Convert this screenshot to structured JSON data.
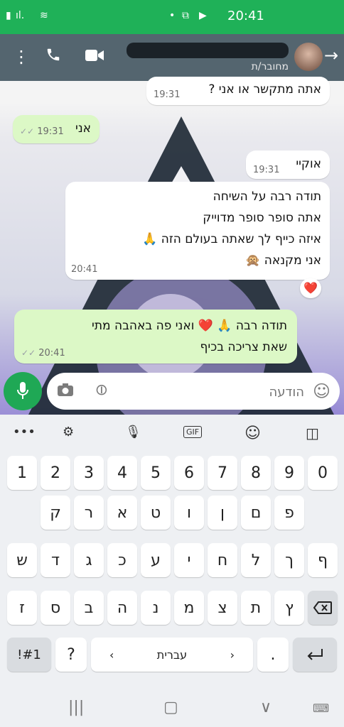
{
  "status_bar": {
    "time": "20:41"
  },
  "header": {
    "contact_status": "מחובר/ת"
  },
  "messages": [
    {
      "text": "אתה מתקשר או אני ?",
      "time": "19:31"
    },
    {
      "text": "אני",
      "time": "19:31"
    },
    {
      "text": "אוקיי",
      "time": "19:31"
    },
    {
      "lines": [
        "תודה רבה על השיחה",
        "אתה סופר סופר מדוייק",
        "איזה כייף לך שאתה בעולם הזה 🙏",
        "אני מקנאה 🙊"
      ],
      "time": "20:41",
      "reaction": "❤️"
    },
    {
      "lines": [
        "תודה רבה 🙏 ❤️ ואני פה באהבה מתי",
        "שאת צריכה בכיף"
      ],
      "time": "20:41"
    }
  ],
  "composer": {
    "placeholder": "הודעה"
  },
  "keyboard": {
    "number_row": [
      "1",
      "2",
      "3",
      "4",
      "5",
      "6",
      "7",
      "8",
      "9",
      "0"
    ],
    "row1": [
      "פ",
      "ם",
      "ן",
      "ו",
      "ט",
      "א",
      "ר",
      "ק"
    ],
    "row2": [
      "ף",
      "ך",
      "ל",
      "ח",
      "י",
      "ע",
      "כ",
      "ג",
      "ד",
      "ש"
    ],
    "row3": [
      "ץ",
      "ת",
      "צ",
      "מ",
      "נ",
      "ה",
      "ב",
      "ס",
      "ז"
    ],
    "symbols_key": "!#1",
    "question_key": "?",
    "language_label": "עברית",
    "period_key": ".",
    "toolbar": {
      "more": "•••",
      "gif": "GIF"
    }
  }
}
